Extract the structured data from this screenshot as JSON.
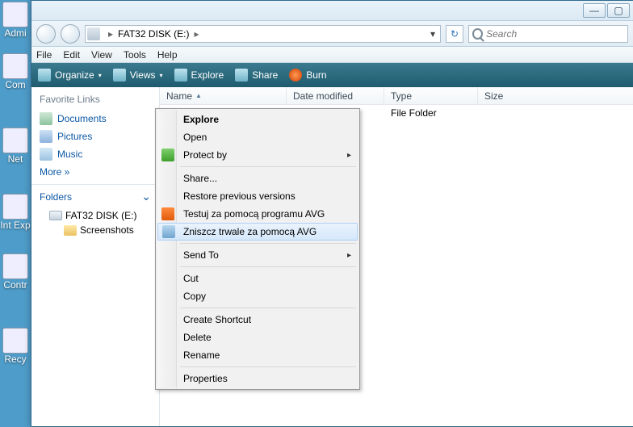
{
  "desktop": {
    "icons": [
      "Admi",
      "Com",
      "Net",
      "Int\nExp",
      "Contr",
      "Recy"
    ]
  },
  "window_controls": {
    "min": "—",
    "max": "▢"
  },
  "address": {
    "path": "FAT32 DISK (E:)",
    "sep": "▸",
    "dropdown": "▾"
  },
  "refresh_glyph": "↻",
  "search": {
    "placeholder": "Search"
  },
  "menubar": [
    "File",
    "Edit",
    "View",
    "Tools",
    "Help"
  ],
  "toolbar": {
    "organize": "Organize",
    "views": "Views",
    "explore": "Explore",
    "share": "Share",
    "burn": "Burn",
    "arrow": "▾"
  },
  "sidebar": {
    "fav_header": "Favorite Links",
    "favorites": [
      "Documents",
      "Pictures",
      "Music"
    ],
    "more": "More  »",
    "folders_header": "Folders",
    "tree_drive": "FAT32 DISK (E:)",
    "tree_child": "Screenshots"
  },
  "columns": {
    "name": "Name",
    "date": "Date modified",
    "type": "Type",
    "size": "Size"
  },
  "row": {
    "name_hidden": "",
    "type": "File Folder"
  },
  "context_menu": {
    "explore": "Explore",
    "open": "Open",
    "protect": "Protect by",
    "share": "Share...",
    "restore": "Restore previous versions",
    "avg_test": "Testuj za pomocą programu AVG",
    "avg_shred": "Zniszcz trwale za pomocą AVG",
    "sendto": "Send To",
    "cut": "Cut",
    "copy": "Copy",
    "shortcut": "Create Shortcut",
    "delete": "Delete",
    "rename": "Rename",
    "properties": "Properties",
    "arrow": "▸"
  }
}
